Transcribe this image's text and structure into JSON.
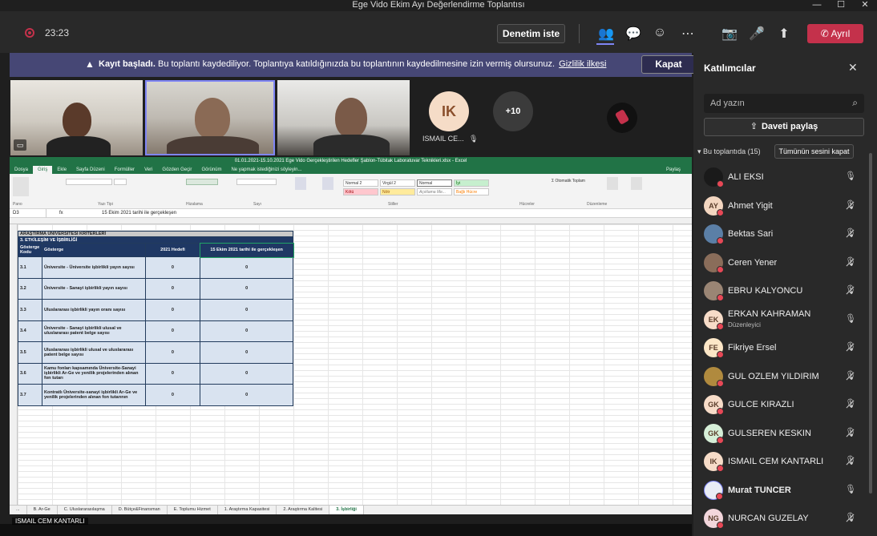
{
  "window": {
    "title": "Ege Vido Ekim Ayı Değerlendirme Toplantısı",
    "controls": [
      "—",
      "☐",
      "✕"
    ]
  },
  "topbar": {
    "timer": "23:23",
    "request_control_label": "Denetim iste",
    "leave_label": "Ayrıl",
    "icons": [
      "people-icon",
      "chat-icon",
      "reactions-icon",
      "more-icon",
      "camera-off-icon",
      "mic-icon",
      "share-icon",
      "phone-icon"
    ]
  },
  "banner": {
    "bold": "Kayıt başladı.",
    "text": "Bu toplantı kaydediliyor. Toplantıya katıldığınızda bu toplantının kaydedilmesine izin vermiş olursunuz.",
    "link": "Gizlilik ilkesi",
    "close_label": "Kapat"
  },
  "videos": {
    "tile4_initials": "IK",
    "tile4_name": "ISMAIL CE...",
    "overflow_count": "+10"
  },
  "excel": {
    "title": "01.01.2021-15.10.2021 Ege Vido Gerçekleştirilen Hedefler Şablon-Tübitak Laboratuvar Teknikleri.xlsx - Excel",
    "ribbon_tabs": [
      "Dosya",
      "Giriş",
      "Ekle",
      "Sayfa Düzeni",
      "Formüller",
      "Veri",
      "Gözden Geçir",
      "Görünüm",
      "Ne yapmak istediğinizi söyleyin..."
    ],
    "active_tab": "Giriş",
    "share": "Paylaş",
    "name_box": "D3",
    "formula": "15 Ekim 2021 tarihi ile gerçekleşen",
    "styles": [
      "Normal 2",
      "Virgül 2",
      "Normal",
      "İyi",
      "Kötü",
      "Nötr",
      "Açıklama Me...",
      "Bağlı Hücre"
    ],
    "groups": [
      "Pano",
      "Yazı Tipi",
      "Hizalama",
      "Sayı",
      "Stiller",
      "Hücreler",
      "Düzenleme"
    ],
    "sheet_header_1": "ARAŞTIRMA ÜNİVERSİTESİ KRİTERLERİ",
    "sheet_header_2": "3. ETKİLEŞİM VE İŞBİRLİĞİ",
    "columns": [
      "Gösterge Kodu",
      "Gösterge",
      "2021 Hedefi",
      "15 Ekim 2021 tarihi ile gerçekleşen"
    ],
    "rows": [
      {
        "code": "3.1",
        "label": "Üniversite - Üniversite işbirlikli yayın sayısı",
        "target": "0",
        "actual": "0"
      },
      {
        "code": "3.2",
        "label": "Üniversite - Sanayi işbirlikli yayın sayısı",
        "target": "0",
        "actual": "0"
      },
      {
        "code": "3.3",
        "label": "Uluslararası işbirlikli yayın oranı sayısı",
        "target": "0",
        "actual": "0"
      },
      {
        "code": "3.4",
        "label": "Üniversite - Sanayi işbirlikli ulusal ve uluslararası patent belge sayısı",
        "target": "0",
        "actual": "0"
      },
      {
        "code": "3.5",
        "label": "Uluslararası işbirlikli ulusal ve uluslararası patent belge sayısı",
        "target": "0",
        "actual": "0"
      },
      {
        "code": "3.6",
        "label": "Kamu fonları kapsamında Üniversite-Sanayi işbirlikli Ar-Ge ve yenilik projelerinden alınan fon tutarı",
        "target": "0",
        "actual": "0"
      },
      {
        "code": "3.7",
        "label": "Kontratlı Üniversite-sanayi işbirlikli Ar-Ge ve yenilik projelerinden alınan fon tutarının",
        "target": "0",
        "actual": "0"
      }
    ],
    "sheet_tabs": [
      "...",
      "B. Ar-Ge",
      "C. Uluslararasılaşma",
      "D. Bütçe&Finansman",
      "E. Toplumu Hizmet",
      "1. Araştırma Kapasitesi",
      "2. Araştırma Kalitesi",
      "3. İşbirliği"
    ],
    "active_sheet": "3. İşbirliği"
  },
  "participants": {
    "title": "Katılımcılar",
    "search_placeholder": "Ad yazın",
    "share_invite": "Daveti paylaş",
    "in_meeting": "Bu toplantıda (15)",
    "mute_all": "Tümünün sesini kapat",
    "list": [
      {
        "initials": "",
        "name": "ALI EKSI",
        "muted": false,
        "color": "#1a1a1a",
        "bold": false,
        "sub": ""
      },
      {
        "initials": "AY",
        "name": "Ahmet Yigit",
        "muted": true,
        "color": "#f3d6c0",
        "bold": false,
        "sub": ""
      },
      {
        "initials": "",
        "name": "Bektas Sari",
        "muted": true,
        "color": "#5b7fa6",
        "bold": false,
        "sub": ""
      },
      {
        "initials": "",
        "name": "Ceren Yener",
        "muted": true,
        "color": "#8a6d5a",
        "bold": false,
        "sub": ""
      },
      {
        "initials": "",
        "name": "EBRU KALYONCU",
        "muted": true,
        "color": "#9a8574",
        "bold": false,
        "sub": ""
      },
      {
        "initials": "EK",
        "name": "ERKAN KAHRAMAN",
        "muted": false,
        "color": "#f7dcc8",
        "bold": false,
        "sub": "Düzenleyici"
      },
      {
        "initials": "FE",
        "name": "Fikriye Ersel",
        "muted": true,
        "color": "#fde7c7",
        "bold": false,
        "sub": ""
      },
      {
        "initials": "",
        "name": "GUL OZLEM YILDIRIM",
        "muted": true,
        "color": "#b08a3e",
        "bold": false,
        "sub": ""
      },
      {
        "initials": "GK",
        "name": "GULCE KIRAZLI",
        "muted": true,
        "color": "#f7dcc8",
        "bold": false,
        "sub": ""
      },
      {
        "initials": "GK",
        "name": "GULSEREN KESKIN",
        "muted": true,
        "color": "#d6efd8",
        "bold": false,
        "sub": ""
      },
      {
        "initials": "IK",
        "name": "ISMAIL CEM KANTARLI",
        "muted": true,
        "color": "#f7dcc8",
        "bold": false,
        "sub": ""
      },
      {
        "initials": "",
        "name": "Murat TUNCER",
        "muted": false,
        "color": "#e9ecf5",
        "bold": true,
        "sub": ""
      },
      {
        "initials": "NG",
        "name": "NURCAN GUZELAY",
        "muted": true,
        "color": "#f3d6dc",
        "bold": false,
        "sub": ""
      }
    ]
  },
  "taskbar": {
    "presenter_name": "ISMAIL CEM KANTARLI"
  }
}
